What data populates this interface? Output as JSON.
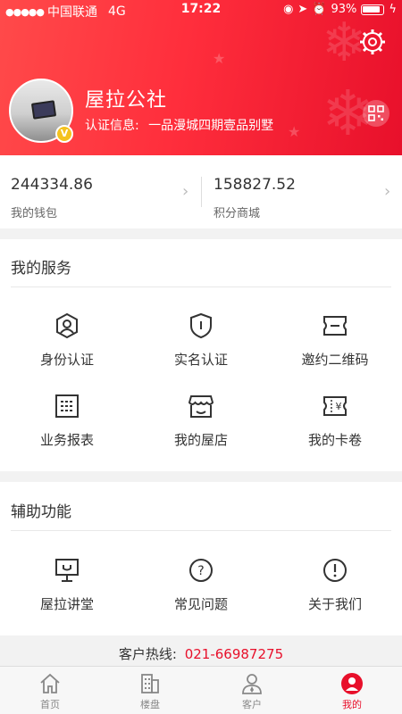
{
  "status_bar": {
    "carrier": "中国联通",
    "network": "4G",
    "time": "17:22",
    "battery": "93%"
  },
  "profile": {
    "name": "屋拉公社",
    "cert_label": "认证信息:",
    "cert_value": "一品漫城四期壹品别墅",
    "badge": "V"
  },
  "wallet": {
    "items": [
      {
        "value": "244334.86",
        "label": "我的钱包"
      },
      {
        "value": "158827.52",
        "label": "积分商城"
      }
    ]
  },
  "services": {
    "title": "我的服务",
    "items": [
      {
        "label": "身份认证",
        "icon": "identity-icon"
      },
      {
        "label": "实名认证",
        "icon": "shield-icon"
      },
      {
        "label": "邀约二维码",
        "icon": "ticket-icon"
      },
      {
        "label": "业务报表",
        "icon": "report-icon"
      },
      {
        "label": "我的屋店",
        "icon": "store-icon"
      },
      {
        "label": "我的卡卷",
        "icon": "coupon-icon"
      }
    ]
  },
  "aux": {
    "title": "辅助功能",
    "items": [
      {
        "label": "屋拉讲堂",
        "icon": "lecture-icon"
      },
      {
        "label": "常见问题",
        "icon": "question-icon"
      },
      {
        "label": "关于我们",
        "icon": "info-icon"
      }
    ]
  },
  "hotline": {
    "label": "客户热线:",
    "number": "021-66987275"
  },
  "tabs": [
    {
      "label": "首页",
      "icon": "home-icon"
    },
    {
      "label": "楼盘",
      "icon": "building-icon"
    },
    {
      "label": "客户",
      "icon": "customer-icon"
    },
    {
      "label": "我的",
      "icon": "profile-icon",
      "active": true
    }
  ],
  "colors": {
    "brand": "#e8102b",
    "header_gradient_start": "#ff4a4a",
    "header_gradient_end": "#e8102b"
  }
}
